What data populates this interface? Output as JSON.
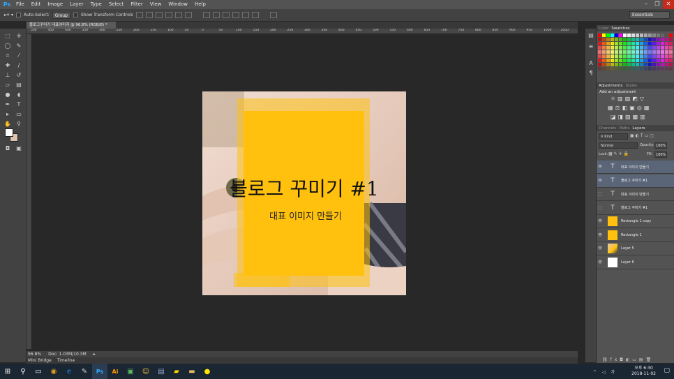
{
  "app": {
    "logo": "Ps"
  },
  "menu": [
    "File",
    "Edit",
    "Image",
    "Layer",
    "Type",
    "Select",
    "Filter",
    "View",
    "Window",
    "Help"
  ],
  "window_controls": [
    "–",
    "❐",
    "✕"
  ],
  "options": {
    "auto_select_label": "Auto-Select:",
    "auto_select_value": "Group",
    "transform_label": "Show Transform Controls",
    "workspace": "Essentials"
  },
  "document": {
    "tab_title": "블로그꾸미기 대표이미지 @ 96.8% (RGB/8) *",
    "title_text": "블로그 꾸미기 #1",
    "subtitle_text": "대표 이미지 만들기",
    "accent_color": "#ffc10e"
  },
  "ruler_top_labels": [
    "500",
    "450",
    "400",
    "350",
    "300",
    "250",
    "200",
    "150",
    "100",
    "50",
    "0",
    "50",
    "100",
    "150",
    "200",
    "250",
    "300",
    "350",
    "400",
    "450",
    "500",
    "550",
    "600",
    "650",
    "700",
    "750",
    "800",
    "850",
    "900",
    "950",
    "1000",
    "1050"
  ],
  "status": {
    "zoom": "96.8%",
    "doc": "Doc: 1.03M/10.3M"
  },
  "bottom_tabs": [
    "Mini Bridge",
    "Timeline"
  ],
  "panels": {
    "color_tabs": [
      "Color",
      "Swatches"
    ],
    "adjust_tabs": [
      "Adjustments",
      "Styles"
    ],
    "add_adjustment": "Add an adjustment",
    "layer_tabs": [
      "Channels",
      "Paths",
      "Layers"
    ],
    "kind": "Kind",
    "blend_mode": "Normal",
    "opacity_label": "Opacity:",
    "opacity_value": "100%",
    "lock_label": "Lock:",
    "fill_label": "Fill:",
    "fill_value": "100%"
  },
  "layers": [
    {
      "name": "대표 이미지 만들기",
      "type": "text",
      "selected": true,
      "visible": true
    },
    {
      "name": "블로그 꾸미기 #1",
      "type": "text",
      "selected": true,
      "visible": true
    },
    {
      "name": "대표 이미지 만들기",
      "type": "text",
      "selected": false,
      "visible": false
    },
    {
      "name": "블로그 꾸미기 #1",
      "type": "text",
      "selected": false,
      "visible": false
    },
    {
      "name": "Rectangle 1 copy",
      "type": "shape",
      "selected": false,
      "visible": true
    },
    {
      "name": "Rectangle 1",
      "type": "shape",
      "selected": false,
      "visible": true
    },
    {
      "name": "Layer 5",
      "type": "image",
      "selected": false,
      "visible": true
    },
    {
      "name": "Layer 6",
      "type": "white",
      "selected": false,
      "visible": true
    }
  ],
  "clock": {
    "time": "오후 6:30",
    "date": "2018-11-02"
  }
}
